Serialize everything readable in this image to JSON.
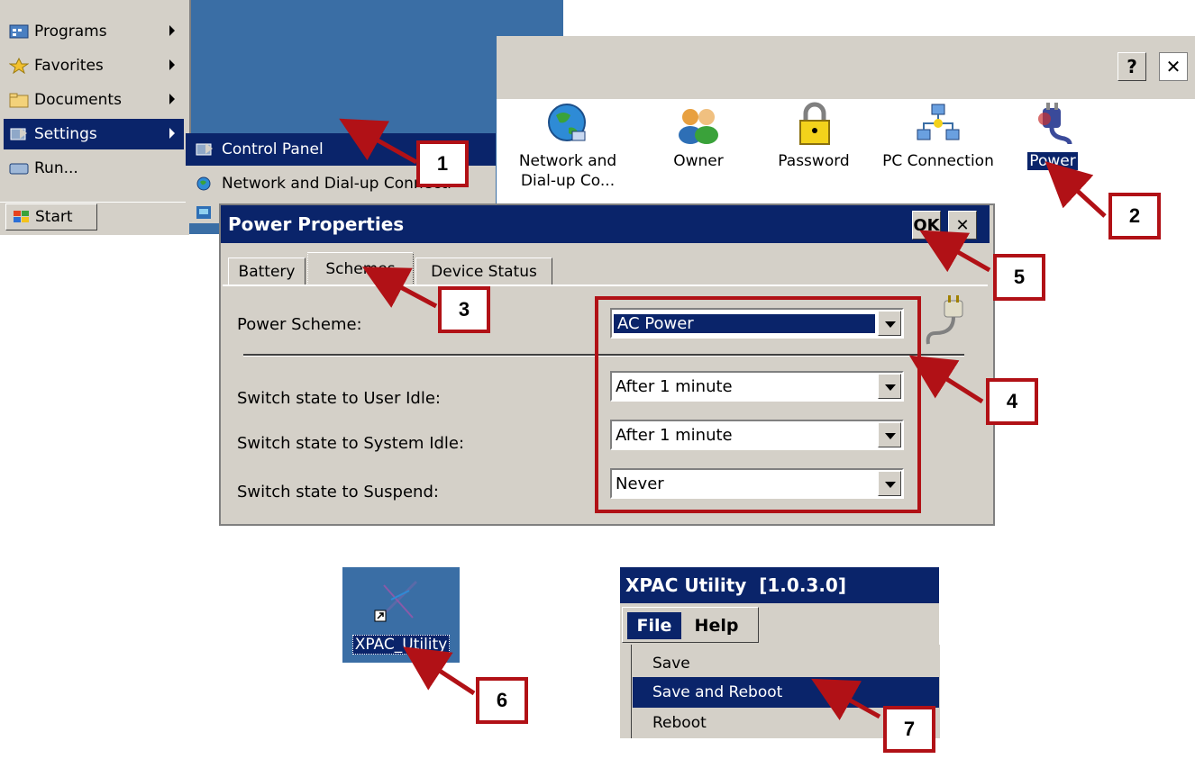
{
  "start_menu": {
    "items": [
      {
        "label": "Programs",
        "icon": "programs-icon"
      },
      {
        "label": "Favorites",
        "icon": "favorites-star-icon"
      },
      {
        "label": "Documents",
        "icon": "documents-folder-icon"
      },
      {
        "label": "Settings",
        "icon": "settings-icon",
        "selected": true
      },
      {
        "label": "Run...",
        "icon": "run-icon"
      }
    ],
    "start_label": "Start"
  },
  "settings_submenu": {
    "items": [
      {
        "label": "Control Panel",
        "selected": true
      },
      {
        "label": "Network and Dial-up Connecti"
      }
    ]
  },
  "control_panel": {
    "help_label": "?",
    "close_label": "✕",
    "icons": [
      {
        "label": "Network and Dial-up Co...",
        "icon": "network-globe-icon"
      },
      {
        "label": "Owner",
        "icon": "owner-people-icon"
      },
      {
        "label": "Password",
        "icon": "password-lock-icon"
      },
      {
        "label": "PC Connection",
        "icon": "pc-connection-icon"
      },
      {
        "label": "Power",
        "icon": "power-plug-icon",
        "selected": true
      }
    ]
  },
  "power_dialog": {
    "title": "Power Properties",
    "ok_label": "OK",
    "close_label": "✕",
    "tabs": [
      "Battery",
      "Schemes",
      "Device Status"
    ],
    "active_tab": "Schemes",
    "power_scheme_label": "Power Scheme:",
    "power_scheme_value": "AC Power",
    "user_idle_label": "Switch state to User Idle:",
    "user_idle_value": "After 1 minute",
    "system_idle_label": "Switch state to System Idle:",
    "system_idle_value": "After 1 minute",
    "suspend_label": "Switch state to Suspend:",
    "suspend_value": "Never"
  },
  "xpac_shortcut": {
    "label": "XPAC_Utility"
  },
  "xpac_window": {
    "title": "XPAC Utility  [1.0.3.0]",
    "menu": [
      "File",
      "Help"
    ],
    "file_items": [
      "Save",
      "Save and Reboot",
      "Reboot"
    ],
    "selected_item": "Save and Reboot"
  },
  "annotations": [
    "1",
    "2",
    "3",
    "4",
    "5",
    "6",
    "7"
  ],
  "colors": {
    "highlight": "#0a246a",
    "annotation_red": "#b11116",
    "desktop": "#3a6ea5",
    "face": "#d4d0c8"
  }
}
